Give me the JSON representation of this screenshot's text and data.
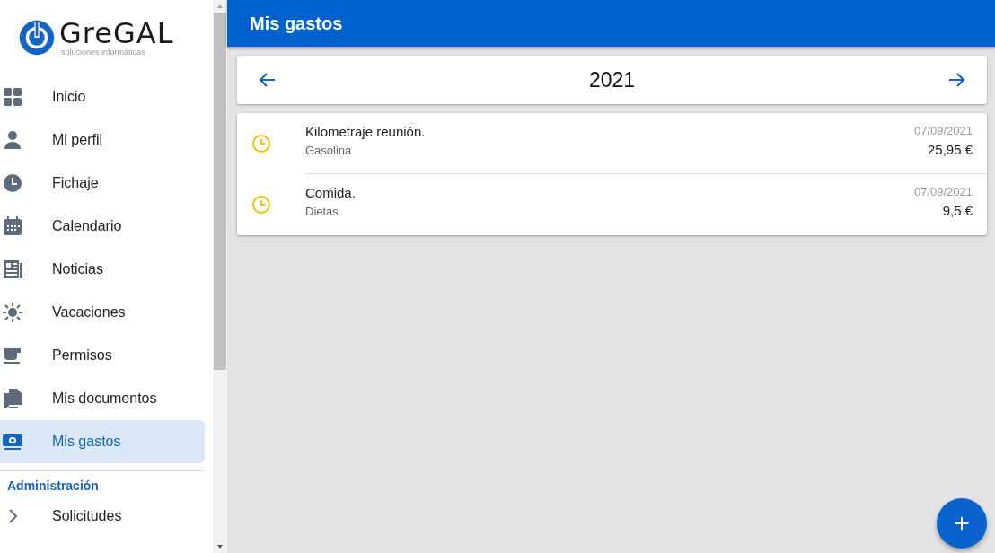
{
  "logo": {
    "name": "GreGAL",
    "tagline": "soluciones informáticas"
  },
  "sidebar": {
    "items": [
      {
        "label": "Inicio",
        "selected": false
      },
      {
        "label": "Mi perfil",
        "selected": false
      },
      {
        "label": "Fichaje",
        "selected": false
      },
      {
        "label": "Calendario",
        "selected": false
      },
      {
        "label": "Noticias",
        "selected": false
      },
      {
        "label": "Vacaciones",
        "selected": false
      },
      {
        "label": "Permisos",
        "selected": false
      },
      {
        "label": "Mis documentos",
        "selected": false
      },
      {
        "label": "Mis gastos",
        "selected": true
      }
    ],
    "section": {
      "title": "Administración",
      "items": [
        {
          "label": "Solicitudes",
          "expanded": false
        }
      ]
    }
  },
  "header": {
    "title": "Mis gastos"
  },
  "year": "2021",
  "expenses": [
    {
      "title": "Kilometraje reunión.",
      "category": "Gasolina",
      "date": "07/09/2021",
      "amount": "25,95 €",
      "color": "#f5c000"
    },
    {
      "title": "Comida.",
      "category": "Dietas",
      "date": "07/09/2021",
      "amount": "9,5 €",
      "color": "#f5c000"
    }
  ]
}
